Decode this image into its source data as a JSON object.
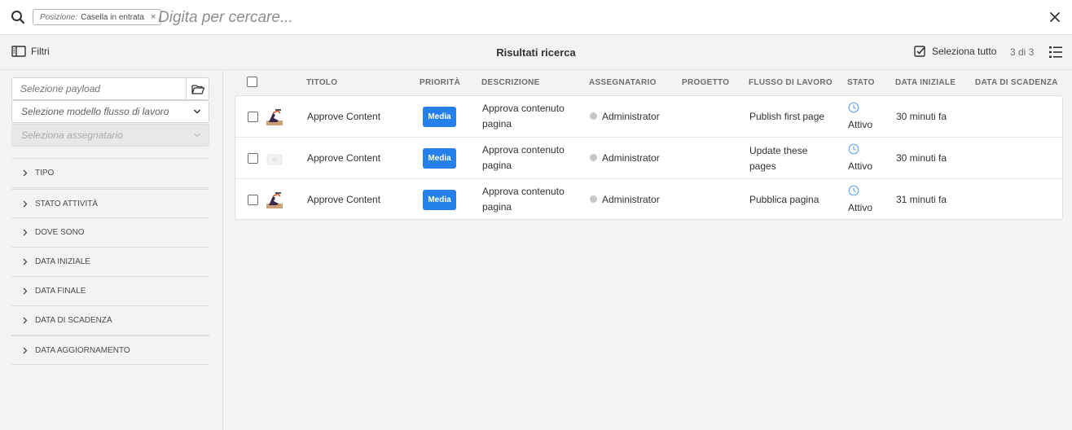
{
  "search": {
    "tag_key": "Posizione:",
    "tag_value": "Casella in entrata",
    "tag_remove": "×",
    "placeholder": "Digita per cercare..."
  },
  "actionbar": {
    "filters_label": "Filtri",
    "title": "Risultati ricerca",
    "select_all_label": "Seleziona tutto",
    "count": "3 di 3"
  },
  "rail": {
    "payload_placeholder": "Selezione payload",
    "workflow_model_placeholder": "Selezione modello flusso di lavoro",
    "assignee_placeholder": "Seleziona assegnatario",
    "sections": [
      "TIPO",
      "STATO ATTIVITÀ",
      "DOVE SONO",
      "DATA INIZIALE",
      "DATA FINALE",
      "DATA DI SCADENZA",
      "DATA AGGIORNAMENTO"
    ]
  },
  "table": {
    "columns": {
      "title": "TITOLO",
      "priority": "PRIORITÀ",
      "description": "DESCRIZIONE",
      "assignee": "ASSEGNATARIO",
      "project": "PROGETTO",
      "workflow": "FLUSSO DI LAVORO",
      "status": "STATO",
      "start_date": "DATA INIZIALE",
      "due_date": "DATA DI SCADENZA"
    },
    "rows": [
      {
        "title": "Approve Content",
        "priority": "Media",
        "description_line1": "Approva contenuto",
        "description_line2": "pagina",
        "assignee": "Administrator",
        "project": "",
        "workflow_line1": "Publish first page",
        "workflow_line2": "",
        "status": "Attivo",
        "start_date": "30 minuti fa",
        "due_date": "",
        "thumbnail": "page-thumbnail"
      },
      {
        "title": "Approve Content",
        "priority": "Media",
        "description_line1": "Approva contenuto",
        "description_line2": "pagina",
        "assignee": "Administrator",
        "project": "",
        "workflow_line1": "Update these",
        "workflow_line2": "pages",
        "status": "Attivo",
        "start_date": "30 minuti fa",
        "due_date": "",
        "thumbnail": "placeholder-thumbnail"
      },
      {
        "title": "Approve Content",
        "priority": "Media",
        "description_line1": "Approva contenuto",
        "description_line2": "pagina",
        "assignee": "Administrator",
        "project": "",
        "workflow_line1": "Pubblica pagina",
        "workflow_line2": "",
        "status": "Attivo",
        "start_date": "31 minuti fa",
        "due_date": "",
        "thumbnail": "page-thumbnail"
      }
    ]
  },
  "colors": {
    "accent": "#2680eb",
    "status_icon": "#6aa9e9"
  }
}
